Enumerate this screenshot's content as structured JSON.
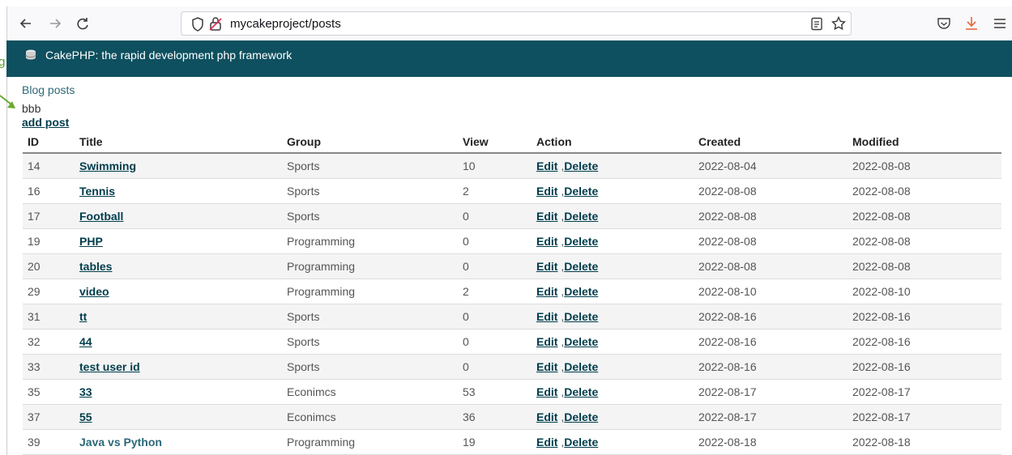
{
  "browser": {
    "url": "mycakeproject/posts",
    "icons": [
      "back-arrow-icon",
      "forward-arrow-icon",
      "reload-icon",
      "shield-icon",
      "lock-broken-icon",
      "reader-view-icon",
      "star-icon",
      "pocket-icon",
      "download-icon",
      "menu-icon"
    ]
  },
  "app": {
    "title": "CakePHP: the rapid development php framework"
  },
  "page": {
    "side_letter": "g",
    "breadcrumb": "Blog posts",
    "flash": "bbb",
    "add_link": "add post"
  },
  "table": {
    "headers": [
      "ID",
      "Title",
      "Group",
      "View",
      "Action",
      "Created",
      "Modified"
    ],
    "edit_label": "Edit",
    "delete_label": "Delete",
    "rows": [
      {
        "id": "14",
        "title": "Swimming",
        "group": "Sports",
        "view": "10",
        "created": "2022-08-04",
        "modified": "2022-08-08"
      },
      {
        "id": "16",
        "title": "Tennis",
        "group": "Sports",
        "view": "2",
        "created": "2022-08-08",
        "modified": "2022-08-08"
      },
      {
        "id": "17",
        "title": "Football",
        "group": "Sports",
        "view": "0",
        "created": "2022-08-08",
        "modified": "2022-08-08"
      },
      {
        "id": "19",
        "title": "PHP",
        "group": "Programming",
        "view": "0",
        "created": "2022-08-08",
        "modified": "2022-08-08"
      },
      {
        "id": "20",
        "title": "tables",
        "group": "Programming",
        "view": "0",
        "created": "2022-08-08",
        "modified": "2022-08-08"
      },
      {
        "id": "29",
        "title": "video",
        "group": "Programming",
        "view": "2",
        "created": "2022-08-10",
        "modified": "2022-08-10"
      },
      {
        "id": "31",
        "title": "tt",
        "group": "Sports",
        "view": "0",
        "created": "2022-08-16",
        "modified": "2022-08-16"
      },
      {
        "id": "32",
        "title": "44",
        "group": "Sports",
        "view": "0",
        "created": "2022-08-16",
        "modified": "2022-08-16"
      },
      {
        "id": "33",
        "title": "test user id",
        "group": "Sports",
        "view": "0",
        "created": "2022-08-16",
        "modified": "2022-08-16"
      },
      {
        "id": "35",
        "title": "33",
        "group": "Econimcs",
        "view": "53",
        "created": "2022-08-17",
        "modified": "2022-08-17"
      },
      {
        "id": "37",
        "title": "55",
        "group": "Econimcs",
        "view": "36",
        "created": "2022-08-17",
        "modified": "2022-08-17"
      },
      {
        "id": "39",
        "title": "Java vs Python",
        "group": "Programming",
        "view": "19",
        "created": "2022-08-18",
        "modified": "2022-08-18"
      }
    ]
  }
}
